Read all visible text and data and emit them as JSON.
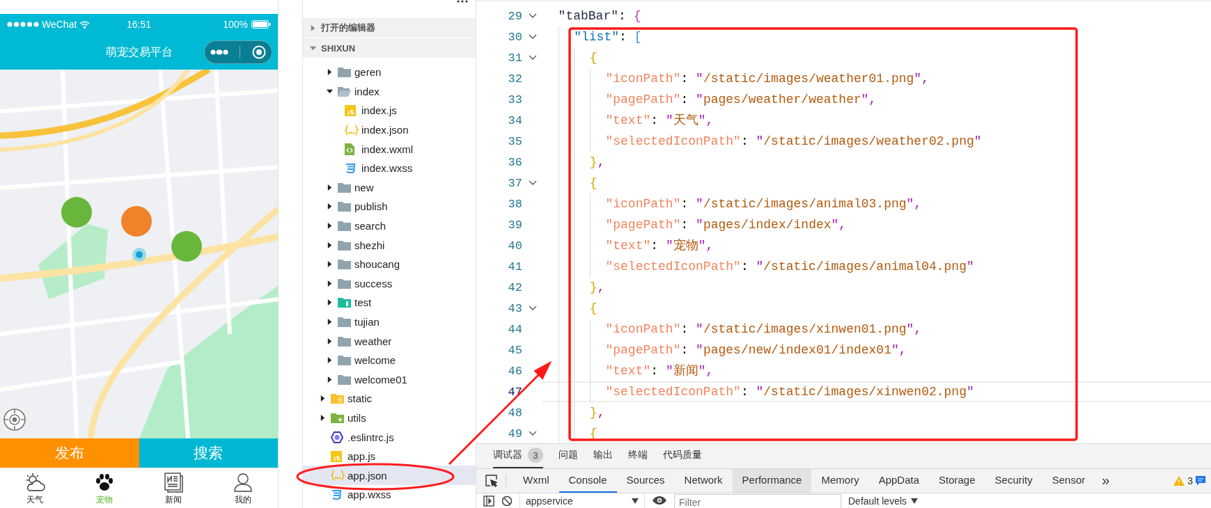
{
  "phone": {
    "status_bar": {
      "carrier": "WeChat",
      "time": "16:51",
      "battery": "100%"
    },
    "nav": {
      "title": "萌宠交易平台"
    },
    "action_buttons": [
      {
        "label": "发布",
        "color": "#ff9100"
      },
      {
        "label": "搜索",
        "color": "#00b8d4"
      }
    ],
    "tab_bar": [
      {
        "label": "天气",
        "kind": "weather",
        "selected": false
      },
      {
        "label": "宠物",
        "kind": "paw",
        "selected": true
      },
      {
        "label": "新闻",
        "kind": "news",
        "selected": false
      },
      {
        "label": "我的",
        "kind": "person",
        "selected": false
      }
    ]
  },
  "sidebar": {
    "sections": [
      {
        "label": "打开的编辑器",
        "expanded": false
      },
      {
        "label": "SHIXUN",
        "expanded": true
      }
    ],
    "tree_nested": [
      {
        "label": "geren",
        "kind": "folder",
        "expanded": false,
        "selected": false
      },
      {
        "label": "index",
        "kind": "folder",
        "expanded": true,
        "selected": false,
        "children": [
          {
            "label": "index.js",
            "kind": "js",
            "selected": false
          },
          {
            "label": "index.json",
            "kind": "json",
            "selected": false
          },
          {
            "label": "index.wxml",
            "kind": "wxml",
            "selected": false
          },
          {
            "label": "index.wxss",
            "kind": "wxss",
            "selected": false
          }
        ]
      },
      {
        "label": "new",
        "kind": "folder",
        "expanded": false,
        "selected": false
      },
      {
        "label": "publish",
        "kind": "folder",
        "expanded": false,
        "selected": false
      },
      {
        "label": "search",
        "kind": "folder",
        "expanded": false,
        "selected": false
      },
      {
        "label": "shezhi",
        "kind": "folder",
        "expanded": false,
        "selected": false
      },
      {
        "label": "shoucang",
        "kind": "folder",
        "expanded": false,
        "selected": false
      },
      {
        "label": "success",
        "kind": "folder",
        "expanded": false,
        "selected": false
      },
      {
        "label": "test",
        "kind": "test-folder",
        "expanded": false,
        "selected": false
      },
      {
        "label": "tujian",
        "kind": "folder",
        "expanded": false,
        "selected": false
      },
      {
        "label": "weather",
        "kind": "folder",
        "expanded": false,
        "selected": false
      },
      {
        "label": "welcome",
        "kind": "folder",
        "expanded": false,
        "selected": false
      },
      {
        "label": "welcome01",
        "kind": "folder",
        "expanded": false,
        "selected": false
      }
    ],
    "tree": [
      {
        "label": "static",
        "kind": "static-folder",
        "expanded": false,
        "selected": false
      },
      {
        "label": "utils",
        "kind": "utils-folder",
        "expanded": false,
        "selected": false
      },
      {
        "label": ".eslintrc.js",
        "kind": "eslint",
        "selected": false
      },
      {
        "label": "app.js",
        "kind": "js",
        "selected": false
      },
      {
        "label": "app.json",
        "kind": "json",
        "selected": true
      },
      {
        "label": "app.wxss",
        "kind": "wxss",
        "selected": false
      }
    ]
  },
  "editor": {
    "lines": [
      {
        "number": "29",
        "text": "  \"tabBar\": {",
        "fold": true,
        "current": false
      },
      {
        "number": "30",
        "text": "    \"list\": [",
        "fold": true,
        "current": false
      },
      {
        "number": "31",
        "text": "      {",
        "fold": true,
        "current": false
      },
      {
        "number": "32",
        "text": "        \"iconPath\": \"/static/images/weather01.png\",",
        "fold": false,
        "current": false
      },
      {
        "number": "33",
        "text": "        \"pagePath\": \"pages/weather/weather\",",
        "fold": false,
        "current": false
      },
      {
        "number": "34",
        "text": "        \"text\": \"天气\",",
        "fold": false,
        "current": false
      },
      {
        "number": "35",
        "text": "        \"selectedIconPath\": \"/static/images/weather02.png\"",
        "fold": false,
        "current": false
      },
      {
        "number": "36",
        "text": "      },",
        "fold": false,
        "current": false
      },
      {
        "number": "37",
        "text": "      {",
        "fold": true,
        "current": false
      },
      {
        "number": "38",
        "text": "        \"iconPath\": \"/static/images/animal03.png\",",
        "fold": false,
        "current": false
      },
      {
        "number": "39",
        "text": "        \"pagePath\": \"pages/index/index\",",
        "fold": false,
        "current": false
      },
      {
        "number": "40",
        "text": "        \"text\": \"宠物\",",
        "fold": false,
        "current": false
      },
      {
        "number": "41",
        "text": "        \"selectedIconPath\": \"/static/images/animal04.png\"",
        "fold": false,
        "current": false
      },
      {
        "number": "42",
        "text": "      },",
        "fold": false,
        "current": false
      },
      {
        "number": "43",
        "text": "      {",
        "fold": true,
        "current": false
      },
      {
        "number": "44",
        "text": "        \"iconPath\": \"/static/images/xinwen01.png\",",
        "fold": false,
        "current": false
      },
      {
        "number": "45",
        "text": "        \"pagePath\": \"pages/new/index01/index01\",",
        "fold": false,
        "current": false
      },
      {
        "number": "46",
        "text": "        \"text\": \"新闻\",",
        "fold": false,
        "current": false
      },
      {
        "number": "47",
        "text": "        \"selectedIconPath\": \"/static/images/xinwen02.png\"",
        "fold": false,
        "current": true
      },
      {
        "number": "48",
        "text": "      },",
        "fold": false,
        "current": false
      },
      {
        "number": "49",
        "text": "      {",
        "fold": true,
        "current": false
      }
    ]
  },
  "devtools": {
    "panel_tabs": [
      {
        "label": "调试器",
        "badge": "3",
        "selected": true
      },
      {
        "label": "问题",
        "selected": false
      },
      {
        "label": "输出",
        "selected": false
      },
      {
        "label": "终端",
        "selected": false
      },
      {
        "label": "代码质量",
        "selected": false
      }
    ],
    "tool_tabs": [
      {
        "label": "Wxml",
        "selected": false,
        "hovered": false
      },
      {
        "label": "Console",
        "selected": true,
        "hovered": false
      },
      {
        "label": "Sources",
        "selected": false,
        "hovered": false
      },
      {
        "label": "Network",
        "selected": false,
        "hovered": false
      },
      {
        "label": "Performance",
        "selected": false,
        "hovered": true
      },
      {
        "label": "Memory",
        "selected": false,
        "hovered": false
      },
      {
        "label": "AppData",
        "selected": false,
        "hovered": false
      },
      {
        "label": "Storage",
        "selected": false,
        "hovered": false
      },
      {
        "label": "Security",
        "selected": false,
        "hovered": false
      },
      {
        "label": "Sensor",
        "selected": false,
        "hovered": false
      }
    ],
    "overflow": "»",
    "warnings": "3",
    "context": "appservice",
    "filter": {
      "placeholder": "Filter"
    },
    "levels": "Default levels"
  }
}
